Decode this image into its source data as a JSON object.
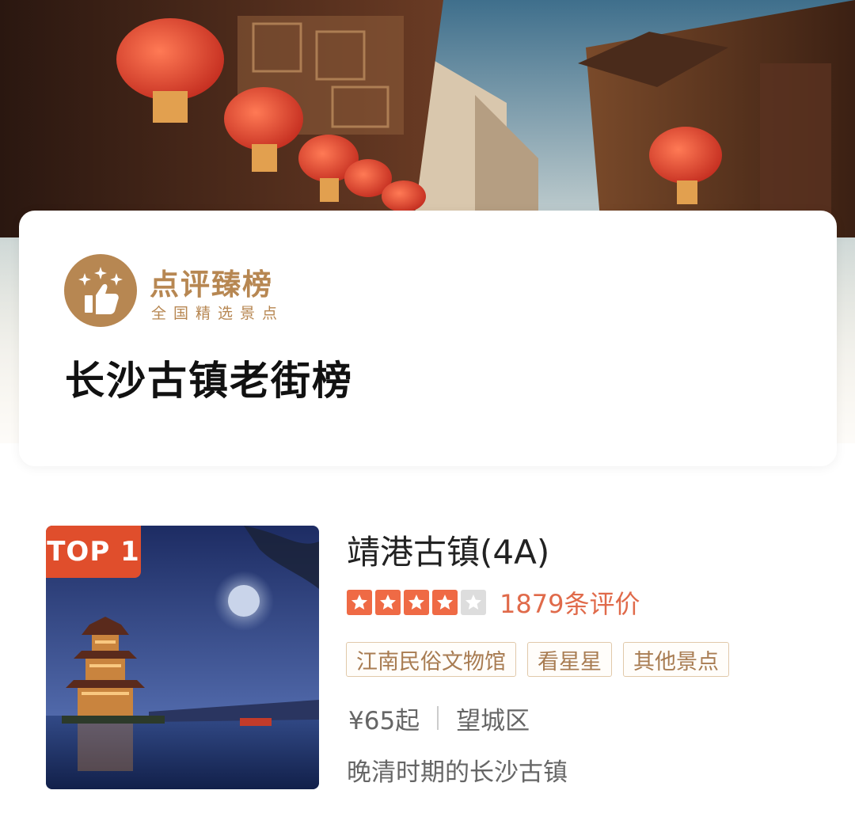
{
  "header": {
    "brand_name": "点评臻榜",
    "brand_subtitle": "全国精选景点",
    "list_title": "长沙古镇老街榜"
  },
  "items": [
    {
      "rank_badge": "TOP 1",
      "name": "靖港古镇(4A)",
      "rating_stars": 4,
      "rating_max": 5,
      "reviews": "1879条评价",
      "tags": [
        "江南民俗文物馆",
        "看星星",
        "其他景点"
      ],
      "price": "¥65起",
      "district": "望城区",
      "description": "晚清时期的长沙古镇"
    }
  ],
  "icons": {
    "brand_logo": "thumbs-up-stars-icon",
    "star": "star-icon"
  },
  "colors": {
    "brand_gold": "#b78752",
    "rank_badge": "#e04e2c",
    "star_filled": "#ef6a45",
    "star_empty": "#dddddd",
    "review_text": "#e06a4a",
    "tag_border": "#e1c9aa",
    "tag_text": "#a87c52"
  }
}
